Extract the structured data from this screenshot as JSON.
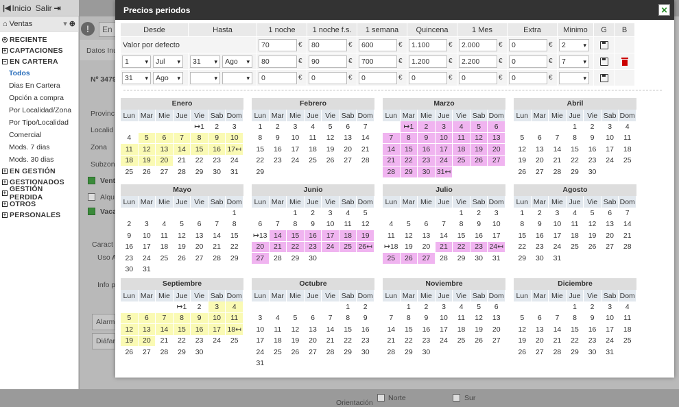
{
  "top": {
    "home": "Inicio",
    "exit": "Salir"
  },
  "sidebar": {
    "module": "Ventas",
    "sections": [
      {
        "label": "RECIENTE",
        "icon": "circle-plus-icon"
      },
      {
        "label": "CAPTACIONES",
        "icon": "plus-box-icon"
      },
      {
        "label": "EN CARTERA",
        "icon": "minus-box-icon"
      }
    ],
    "items": [
      "Todos",
      "Dias En Cartera",
      "Opción a compra",
      "Por Localidad/Zona",
      "Por Tipo/Localidad",
      "Comercial",
      "Mods. 7 dias",
      "Mods. 30 dias"
    ],
    "sections2": [
      "EN GESTIÓN",
      "GESTIONADOS",
      "GESTIÓN PERDIDA",
      "OTROS",
      "PERSONALES"
    ]
  },
  "bg": {
    "input_placeholder": "En",
    "tab": "Datos Inu",
    "ref": "Nº 3479",
    "provincia": "Provinc",
    "localidad": "Localid",
    "zona": "Zona",
    "subzona": "Subzon",
    "venta": "Vent",
    "alquiler": "Alqu",
    "vacaciones": "Vaca",
    "caract": "Caract",
    "uso": "Uso A",
    "info": "Info p",
    "alarma": "Alarm",
    "diafano": "Diáfan",
    "orientacion": "Orientación",
    "norte": "Norte",
    "sur": "Sur"
  },
  "modal": {
    "title": "Precios periodos",
    "headers": [
      "Desde",
      "Hasta",
      "1 noche",
      "1 noche f.s.",
      "1 semana",
      "Quincena",
      "1 Mes",
      "Extra",
      "Minimo",
      "G",
      "B"
    ],
    "currency": "€",
    "default_row": {
      "label": "Valor por defecto",
      "noche": "70",
      "noche_fs": "80",
      "semana": "600",
      "quincena": "1.100",
      "mes": "2.000",
      "extra": "0",
      "minimo": "2"
    },
    "row1": {
      "d_day": "1",
      "d_month": "Jul",
      "h_day": "31",
      "h_month": "Ago",
      "noche": "80",
      "noche_fs": "90",
      "semana": "700",
      "quincena": "1.200",
      "mes": "2.200",
      "extra": "0",
      "minimo": "7"
    },
    "row2": {
      "d_day": "31",
      "d_month": "Ago",
      "h_day": "",
      "h_month": "",
      "noche": "0",
      "noche_fs": "0",
      "semana": "0",
      "quincena": "0",
      "mes": "0",
      "extra": "0",
      "minimo": ""
    }
  },
  "calendar": {
    "weekdays": [
      "Lun",
      "Mar",
      "Mie",
      "Jue",
      "Vie",
      "Sab",
      "Dom"
    ],
    "months": [
      {
        "name": "Enero",
        "cells": [
          "",
          "",
          "",
          "",
          "↦1",
          "2",
          "3",
          "4",
          "5",
          "6",
          "7",
          "8",
          "9",
          "10",
          "11",
          "12",
          "13",
          "14",
          "15",
          "16",
          "17↤",
          "18",
          "19",
          "20",
          "21",
          "22",
          "23",
          "24",
          "25",
          "26",
          "27",
          "28",
          "29",
          "30",
          "31"
        ],
        "hl": {
          "5": "y",
          "6": "y",
          "7": "y",
          "8": "y",
          "9": "y",
          "10": "y",
          "11": "y",
          "12": "y",
          "13": "y",
          "14": "y",
          "15": "y",
          "16": "y",
          "17": "y",
          "18": "y",
          "19": "y",
          "20": "y"
        }
      },
      {
        "name": "Febrero",
        "cells": [
          "1",
          "2",
          "3",
          "4",
          "5",
          "6",
          "7",
          "8",
          "9",
          "10",
          "11",
          "12",
          "13",
          "14",
          "15",
          "16",
          "17",
          "18",
          "19",
          "20",
          "21",
          "22",
          "23",
          "24",
          "25",
          "26",
          "27",
          "28",
          "29"
        ],
        "hl": {}
      },
      {
        "name": "Marzo",
        "cells": [
          "",
          "↦1",
          "2",
          "3",
          "4",
          "5",
          "6",
          "7",
          "8",
          "9",
          "10",
          "11",
          "12",
          "13",
          "14",
          "15",
          "16",
          "17",
          "18",
          "19",
          "20",
          "21",
          "22",
          "23",
          "24",
          "25",
          "26",
          "27",
          "28",
          "29",
          "30",
          "31↤"
        ],
        "hl": {
          "1": "p",
          "2": "p",
          "3": "p",
          "4": "p",
          "5": "p",
          "6": "p",
          "7": "p",
          "8": "p",
          "9": "p",
          "10": "p",
          "11": "p",
          "12": "p",
          "13": "p",
          "14": "p",
          "15": "p",
          "16": "p",
          "17": "p",
          "18": "p",
          "19": "p",
          "20": "p",
          "21": "p",
          "22": "p",
          "23": "p",
          "24": "p",
          "25": "p",
          "26": "p",
          "27": "p",
          "28": "p",
          "29": "p",
          "30": "p",
          "31": "p"
        }
      },
      {
        "name": "Abril",
        "cells": [
          "",
          "",
          "",
          "1",
          "2",
          "3",
          "4",
          "5",
          "6",
          "7",
          "8",
          "9",
          "10",
          "11",
          "12",
          "13",
          "14",
          "15",
          "16",
          "17",
          "18",
          "19",
          "20",
          "21",
          "22",
          "23",
          "24",
          "25",
          "26",
          "27",
          "28",
          "29",
          "30"
        ],
        "hl": {}
      },
      {
        "name": "Mayo",
        "cells": [
          "",
          "",
          "",
          "",
          "",
          "",
          "1",
          "2",
          "3",
          "4",
          "5",
          "6",
          "7",
          "8",
          "9",
          "10",
          "11",
          "12",
          "13",
          "14",
          "15",
          "16",
          "17",
          "18",
          "19",
          "20",
          "21",
          "22",
          "23",
          "24",
          "25",
          "26",
          "27",
          "28",
          "29",
          "30",
          "31"
        ],
        "hl": {}
      },
      {
        "name": "Junio",
        "cells": [
          "",
          "",
          "1",
          "2",
          "3",
          "4",
          "5",
          "6",
          "7",
          "8",
          "9",
          "10",
          "11",
          "12",
          "↦13",
          "14",
          "15",
          "16",
          "17",
          "18",
          "19",
          "20",
          "21",
          "22",
          "23",
          "24",
          "25",
          "26↤",
          "27",
          "28",
          "29",
          "30"
        ],
        "hl": {
          "14": "p",
          "15": "p",
          "16": "p",
          "17": "p",
          "18": "p",
          "19": "p",
          "20": "p",
          "21": "p",
          "22": "p",
          "23": "p",
          "24": "p",
          "25": "p",
          "26": "p",
          "27": "p"
        }
      },
      {
        "name": "Julio",
        "cells": [
          "",
          "",
          "",
          "",
          "1",
          "2",
          "3",
          "4",
          "5",
          "6",
          "7",
          "8",
          "9",
          "10",
          "11",
          "12",
          "13",
          "14",
          "15",
          "16",
          "17",
          "↦18",
          "19",
          "20",
          "21",
          "22",
          "23",
          "24↤",
          "25",
          "26",
          "27",
          "28",
          "29",
          "30",
          "31"
        ],
        "hl": {
          "21": "p",
          "22": "p",
          "23": "p",
          "24": "p",
          "25": "p",
          "26": "p",
          "27": "p"
        }
      },
      {
        "name": "Agosto",
        "cells": [
          "1",
          "2",
          "3",
          "4",
          "5",
          "6",
          "7",
          "8",
          "9",
          "10",
          "11",
          "12",
          "13",
          "14",
          "15",
          "16",
          "17",
          "18",
          "19",
          "20",
          "21",
          "22",
          "23",
          "24",
          "25",
          "26",
          "27",
          "28",
          "29",
          "30",
          "31"
        ],
        "hl": {}
      },
      {
        "name": "Septiembre",
        "cells": [
          "",
          "",
          "",
          "↦1",
          "2",
          "3",
          "4",
          "5",
          "6",
          "7",
          "8",
          "9",
          "10",
          "11",
          "12",
          "13",
          "14",
          "15",
          "16",
          "17",
          "18↤",
          "19",
          "20",
          "21",
          "22",
          "23",
          "24",
          "25",
          "26",
          "27",
          "28",
          "29",
          "30"
        ],
        "hl": {
          "3": "y",
          "4": "y",
          "5": "y",
          "6": "y",
          "7": "y",
          "8": "y",
          "9": "y",
          "10": "y",
          "11": "y",
          "12": "y",
          "13": "y",
          "14": "y",
          "15": "y",
          "16": "y",
          "17": "y",
          "18": "y",
          "19": "y",
          "20": "y"
        }
      },
      {
        "name": "Octubre",
        "cells": [
          "",
          "",
          "",
          "",
          "",
          "1",
          "2",
          "3",
          "4",
          "5",
          "6",
          "7",
          "8",
          "9",
          "10",
          "11",
          "12",
          "13",
          "14",
          "15",
          "16",
          "17",
          "18",
          "19",
          "20",
          "21",
          "22",
          "23",
          "24",
          "25",
          "26",
          "27",
          "28",
          "29",
          "30",
          "31"
        ],
        "hl": {}
      },
      {
        "name": "Noviembre",
        "cells": [
          "",
          "1",
          "2",
          "3",
          "4",
          "5",
          "6",
          "7",
          "8",
          "9",
          "10",
          "11",
          "12",
          "13",
          "14",
          "15",
          "16",
          "17",
          "18",
          "19",
          "20",
          "21",
          "22",
          "23",
          "24",
          "25",
          "26",
          "27",
          "28",
          "29",
          "30"
        ],
        "hl": {}
      },
      {
        "name": "Diciembre",
        "cells": [
          "",
          "",
          "",
          "1",
          "2",
          "3",
          "4",
          "5",
          "6",
          "7",
          "8",
          "9",
          "10",
          "11",
          "12",
          "13",
          "14",
          "15",
          "16",
          "17",
          "18",
          "19",
          "20",
          "21",
          "22",
          "23",
          "24",
          "25",
          "26",
          "27",
          "28",
          "29",
          "30",
          "31"
        ],
        "hl": {}
      }
    ]
  }
}
